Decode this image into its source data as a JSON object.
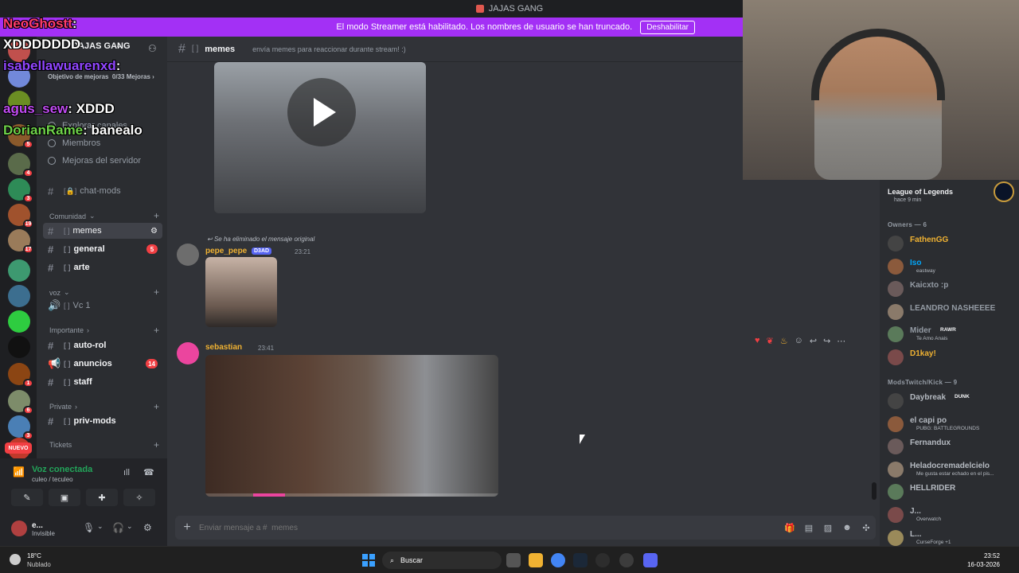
{
  "window": {
    "title": "JAJAS GANG"
  },
  "banner": {
    "text": "El modo Streamer está habilitado. Los nombres de usuario se han truncado.",
    "button": "Deshabilitar"
  },
  "server": {
    "name": "JAJAS GANG",
    "boost_goal": "Objetivo de mejoras",
    "boost_progress": "0/33 Mejoras",
    "menu": [
      "Explorar canales",
      "Miembros",
      "Mejoras del servidor"
    ]
  },
  "rail_badges": [
    "5",
    "4",
    "3",
    "19",
    "17",
    "1",
    "6",
    "3"
  ],
  "nuevo": "NUEVO",
  "channels": {
    "chat_mods": "chat-mods",
    "cat_comunidad": "Comunidad",
    "memes": "memes",
    "general": "general",
    "general_count": "5",
    "arte": "arte",
    "cat_voz": "voz",
    "vc1": "Vc 1",
    "cat_importante": "Importante",
    "auto_rol": "auto-rol",
    "anuncios": "anuncios",
    "anuncios_count": "14",
    "staff": "staff",
    "cat_private": "Private",
    "priv_mods": "priv-mods",
    "cat_tickets": "Tickets"
  },
  "voice": {
    "status": "Voz conectada",
    "channel": "culeo / teculeo"
  },
  "user": {
    "name": "e...",
    "status": "Invisible"
  },
  "header": {
    "channel": "memes",
    "topic": "envía memes para reaccionar durante stream! :)"
  },
  "messages": {
    "reply_note": "Se ha eliminado el mensaje original",
    "m1_author": "pepe_pepe",
    "m1_tag": "D3AD",
    "m1_time": "23:21",
    "m2_author": "sebastian",
    "m2_time": "23:41"
  },
  "composer": {
    "placeholder": "Enviar mensaje a #  memes"
  },
  "members": {
    "activity_game": "League of Legends",
    "activity_time": "hace 9 min",
    "group1": "Owners — 6",
    "group2": "ModsTwitch/Kick — 9",
    "list1": [
      {
        "name": "FathenGG",
        "sub": "",
        "color": "#f0b232"
      },
      {
        "name": "Iso",
        "sub": "eastway",
        "color": "#00a8fc"
      },
      {
        "name": "Kaicxto :p",
        "sub": "",
        "color": "#949ba4"
      },
      {
        "name": "LEANDRO NASHEEEE",
        "sub": "",
        "color": "#949ba4"
      },
      {
        "name": "Mider",
        "sub": "Te Amo Anais",
        "color": "#949ba4",
        "tag": "RAWR"
      },
      {
        "name": "D1kay!",
        "sub": "",
        "color": "#f0b232"
      }
    ],
    "list2": [
      {
        "name": "Daybreak",
        "sub": "",
        "color": "#b5bac1",
        "tag": "DUNK"
      },
      {
        "name": "el capi po",
        "sub": "PUBG: BATTLEGROUNDS",
        "color": "#b5bac1"
      },
      {
        "name": "Fernandux",
        "sub": "",
        "color": "#b5bac1"
      },
      {
        "name": "Heladocremadelcielo",
        "sub": "Me gusta estar echado en el pis...",
        "color": "#b5bac1"
      },
      {
        "name": "HELLRIDER",
        "sub": "",
        "color": "#b5bac1"
      },
      {
        "name": "J...",
        "sub": "Overwatch",
        "color": "#b5bac1"
      },
      {
        "name": "L...",
        "sub": "CurseForge +1",
        "color": "#b5bac1"
      }
    ]
  },
  "stream_chat": [
    {
      "user": "NeoGhostt",
      "msg": ""
    },
    {
      "user": "",
      "msg": "XDDDDDDD"
    },
    {
      "user": "isabellawuarenxd",
      "msg": ""
    },
    {
      "user": "agus_sew",
      "msg": ": XDDD"
    },
    {
      "user": "DorianRame",
      "msg": ": banealo"
    }
  ],
  "taskbar": {
    "temp": "18°C",
    "weather": "Nublado",
    "search": "Buscar",
    "time": "23:52",
    "date": "16-03-2026"
  },
  "colors": {
    "banner": "#a330f5",
    "accent": "#5865f2",
    "online": "#23a55a",
    "alert": "#f23f43"
  }
}
